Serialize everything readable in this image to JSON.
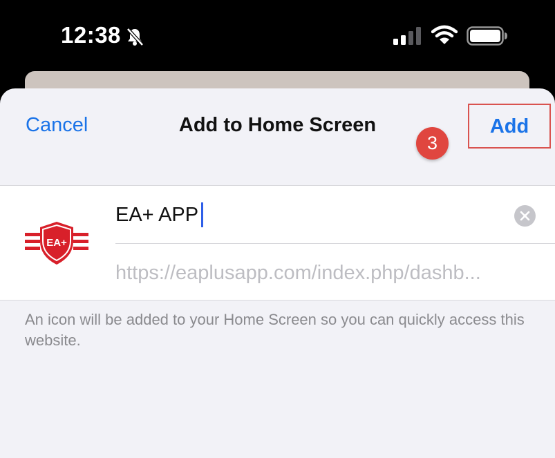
{
  "status_bar": {
    "time": "12:38",
    "icons": [
      "bell-slash-icon",
      "cellular-signal-icon",
      "wifi-icon",
      "battery-icon"
    ]
  },
  "nav": {
    "cancel_label": "Cancel",
    "title": "Add to Home Screen",
    "add_label": "Add",
    "step_badge": "3"
  },
  "form": {
    "name_value": "EA+ APP",
    "url": "https://eaplusapp.com/index.php/dashb...",
    "app_icon_text": "EA+",
    "clear_icon": "clear-icon"
  },
  "helper_text": "An icon will be added to your Home Screen so you can quickly access this website.",
  "colors": {
    "accent": "#1a73e8",
    "badge": "#e0463f",
    "highlight_border": "#d9534f",
    "brand": "#d8202a"
  }
}
